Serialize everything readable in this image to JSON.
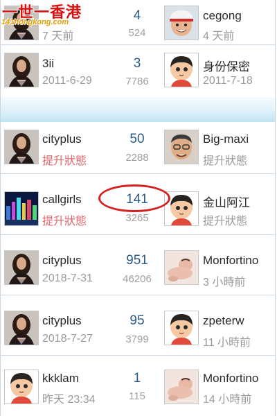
{
  "logo": {
    "title": "一世一香港",
    "domain": "141hongkong.com"
  },
  "rows": [
    {
      "left_name": "",
      "left_sub": "7 天前",
      "number": "4",
      "count": "524",
      "right_name": "cegong",
      "right_sub": "4 天前",
      "left_avatar": "woman-icon",
      "right_avatar": "kid-cap-icon"
    },
    {
      "left_name": "3ii",
      "left_sub": "2011-6-29",
      "number": "3",
      "count": "7786",
      "right_name": "身份保密",
      "right_sub": "2011-7-18",
      "left_avatar": "woman-icon",
      "right_avatar": "default-avatar-icon"
    },
    {
      "left_name": "cityplus",
      "left_sub": "提升狀態",
      "number": "50",
      "count": "2288",
      "right_name": "Big-maxi",
      "right_sub": "提升狀態",
      "left_avatar": "woman-icon",
      "right_avatar": "man-glasses-icon"
    },
    {
      "left_name": "callgirls",
      "left_sub": "提升狀態",
      "number": "141",
      "count": "3265",
      "right_name": "金山阿江",
      "right_sub": "提升狀態",
      "left_avatar": "cityscape-icon",
      "right_avatar": "default-avatar-icon"
    },
    {
      "left_name": "cityplus",
      "left_sub": "2018-7-31",
      "number": "951",
      "count": "46206",
      "right_name": "Monfortino",
      "right_sub": "3 小時前",
      "left_avatar": "woman-icon",
      "right_avatar": "baby-photo-icon"
    },
    {
      "left_name": "cityplus",
      "left_sub": "2018-7-27",
      "number": "95",
      "count": "3799",
      "right_name": "zpeterw",
      "right_sub": "11 小時前",
      "left_avatar": "woman-icon",
      "right_avatar": "default-avatar-icon"
    },
    {
      "left_name": "kkklam",
      "left_sub": "昨天 23:34",
      "number": "1",
      "count": "115",
      "right_name": "Monfortino",
      "right_sub": "14 小時前",
      "left_avatar": "default-avatar-icon",
      "right_avatar": "baby-photo-icon"
    }
  ],
  "colors": {
    "number": "#2b5a86",
    "status_red": "#e0676c",
    "muted": "#9a9a9a",
    "annotation": "#d42020",
    "divider_band": "#c2e4f4"
  }
}
